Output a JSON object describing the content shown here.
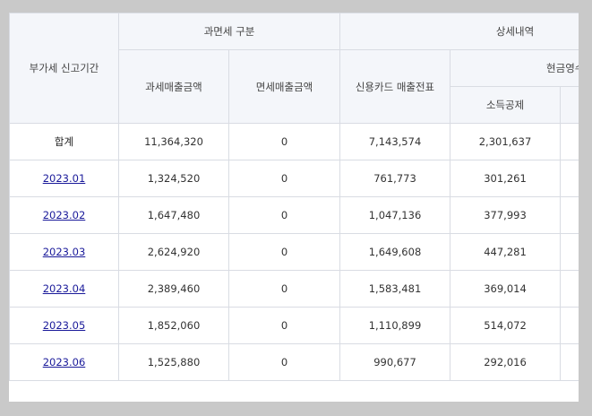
{
  "headers": {
    "period": "부가세 신고기간",
    "tax_group": "과면세 구분",
    "taxable_sales": "과세매출금액",
    "exempt_sales": "면세매출금액",
    "detail_group": "상세내역",
    "card_sales": "신용카드 매출전표",
    "cash_receipt": "현금영수증",
    "income_deduction": "소득공제"
  },
  "total_row": {
    "label": "합계",
    "taxable": "11,364,320",
    "exempt": "0",
    "card": "7,143,574",
    "income_deduction": "2,301,637"
  },
  "rows": [
    {
      "period": "2023.01",
      "taxable": "1,324,520",
      "exempt": "0",
      "card": "761,773",
      "income_deduction": "301,261"
    },
    {
      "period": "2023.02",
      "taxable": "1,647,480",
      "exempt": "0",
      "card": "1,047,136",
      "income_deduction": "377,993"
    },
    {
      "period": "2023.03",
      "taxable": "2,624,920",
      "exempt": "0",
      "card": "1,649,608",
      "income_deduction": "447,281"
    },
    {
      "period": "2023.04",
      "taxable": "2,389,460",
      "exempt": "0",
      "card": "1,583,481",
      "income_deduction": "369,014"
    },
    {
      "period": "2023.05",
      "taxable": "1,852,060",
      "exempt": "0",
      "card": "1,110,899",
      "income_deduction": "514,072"
    },
    {
      "period": "2023.06",
      "taxable": "1,525,880",
      "exempt": "0",
      "card": "990,677",
      "income_deduction": "292,016"
    }
  ]
}
